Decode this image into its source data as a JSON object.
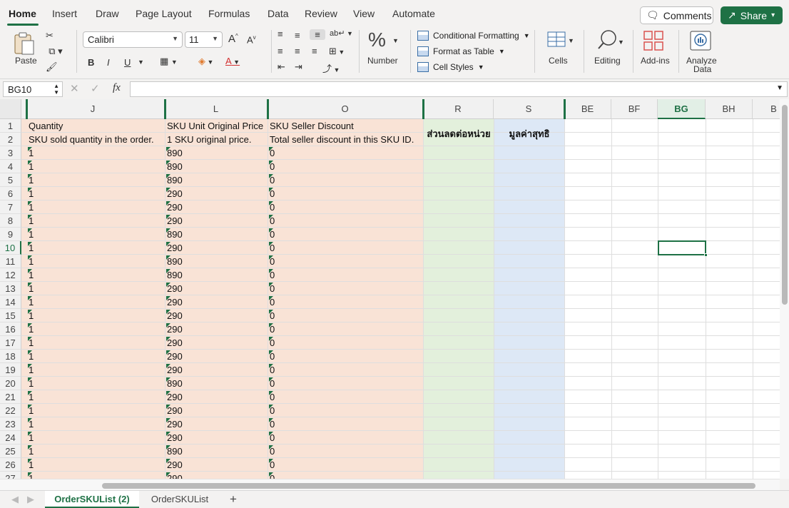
{
  "menu": {
    "tabs": [
      "Home",
      "Insert",
      "Draw",
      "Page Layout",
      "Formulas",
      "Data",
      "Review",
      "View",
      "Automate"
    ],
    "comments_label": "Comments",
    "share_label": "Share"
  },
  "ribbon": {
    "paste_label": "Paste",
    "font_name": "Calibri",
    "font_size": "11",
    "bold": "B",
    "italic": "I",
    "underline": "U",
    "grow_font": "A",
    "shrink_font": "A",
    "number_label": "Number",
    "conditional_formatting": "Conditional Formatting",
    "format_as_table": "Format as Table",
    "cell_styles": "Cell Styles",
    "cells_label": "Cells",
    "editing_label": "Editing",
    "addins_label": "Add-ins",
    "analyze_label_1": "Analyze",
    "analyze_label_2": "Data"
  },
  "formula_bar": {
    "name_box": "BG10",
    "fx_label": "fx",
    "formula": ""
  },
  "colors": {
    "accent": "#1e7145",
    "peach_fill": "#f9e3d6",
    "green_fill": "#e3f0dc",
    "blue_fill": "#dde8f6"
  },
  "grid": {
    "columns": [
      "J",
      "L",
      "O",
      "R",
      "S",
      "BE",
      "BF",
      "BG",
      "BH",
      "B"
    ],
    "selected_column": "BG",
    "selected_row": "10",
    "rows": [
      "1",
      "2",
      "3",
      "4",
      "5",
      "6",
      "7",
      "8",
      "9",
      "10",
      "11",
      "12",
      "13",
      "14",
      "15",
      "16",
      "17",
      "18",
      "19",
      "20",
      "21",
      "22",
      "23",
      "24",
      "25",
      "26",
      "27"
    ],
    "header_row1": {
      "J": "Quantity",
      "L": "SKU Unit Original Price",
      "O": "SKU Seller Discount",
      "R": "ส่วนลดต่อหน่วย",
      "S": "มูลค่าสุทธิ"
    },
    "header_row2": {
      "J": "SKU sold quantity in the order.",
      "L": "1 SKU original price.",
      "O": "Total seller discount in this SKU ID."
    },
    "data": [
      [
        "1",
        "890",
        "0"
      ],
      [
        "1",
        "890",
        "0"
      ],
      [
        "1",
        "890",
        "0"
      ],
      [
        "1",
        "290",
        "0"
      ],
      [
        "1",
        "290",
        "0"
      ],
      [
        "1",
        "290",
        "0"
      ],
      [
        "1",
        "890",
        "0"
      ],
      [
        "1",
        "290",
        "0"
      ],
      [
        "1",
        "890",
        "0"
      ],
      [
        "1",
        "890",
        "0"
      ],
      [
        "1",
        "290",
        "0"
      ],
      [
        "1",
        "290",
        "0"
      ],
      [
        "1",
        "290",
        "0"
      ],
      [
        "1",
        "290",
        "0"
      ],
      [
        "1",
        "290",
        "0"
      ],
      [
        "1",
        "290",
        "0"
      ],
      [
        "1",
        "290",
        "0"
      ],
      [
        "1",
        "890",
        "0"
      ],
      [
        "1",
        "290",
        "0"
      ],
      [
        "1",
        "290",
        "0"
      ],
      [
        "1",
        "290",
        "0"
      ],
      [
        "1",
        "290",
        "0"
      ],
      [
        "1",
        "890",
        "0"
      ],
      [
        "1",
        "290",
        "0"
      ],
      [
        "1",
        "290",
        "0"
      ]
    ]
  },
  "sheets": {
    "tabs": [
      "OrderSKUList (2)",
      "OrderSKUList"
    ],
    "active": "OrderSKUList (2)",
    "add_label": "+"
  }
}
